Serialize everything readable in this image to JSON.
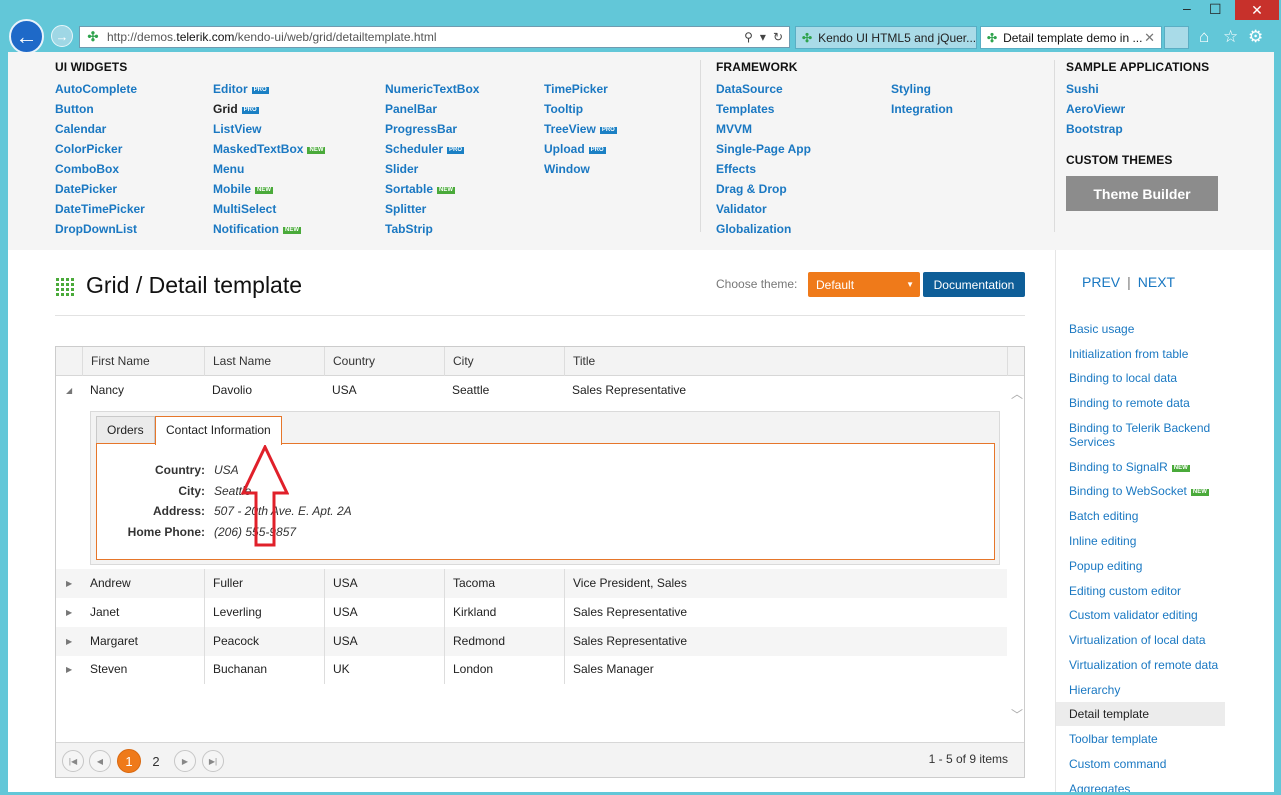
{
  "browser": {
    "url_host_prefix": "http://demos.",
    "url_host": "telerik.com",
    "url_path": "/kendo-ui/web/grid/detailtemplate.html",
    "tabs": [
      {
        "title": "Kendo UI HTML5 and jQuer..."
      },
      {
        "title": "Detail template demo in ..."
      }
    ]
  },
  "menu": {
    "ui_widgets_title": "UI WIDGETS",
    "col1": [
      "AutoComplete",
      "Button",
      "Calendar",
      "ColorPicker",
      "ComboBox",
      "DatePicker",
      "DateTimePicker",
      "DropDownList"
    ],
    "col2": [
      {
        "label": "Editor",
        "badge": "PRO"
      },
      {
        "label": "Grid",
        "badge": "PRO"
      },
      {
        "label": "ListView",
        "badge": ""
      },
      {
        "label": "MaskedTextBox",
        "badge": "NEW"
      },
      {
        "label": "Menu",
        "badge": ""
      },
      {
        "label": "Mobile",
        "badge": "NEW"
      },
      {
        "label": "MultiSelect",
        "badge": ""
      },
      {
        "label": "Notification",
        "badge": "NEW"
      }
    ],
    "col3": [
      {
        "label": "NumericTextBox",
        "badge": ""
      },
      {
        "label": "PanelBar",
        "badge": ""
      },
      {
        "label": "ProgressBar",
        "badge": ""
      },
      {
        "label": "Scheduler",
        "badge": "PRO"
      },
      {
        "label": "Slider",
        "badge": ""
      },
      {
        "label": "Sortable",
        "badge": "NEW"
      },
      {
        "label": "Splitter",
        "badge": ""
      },
      {
        "label": "TabStrip",
        "badge": ""
      }
    ],
    "col4": [
      {
        "label": "TimePicker",
        "badge": ""
      },
      {
        "label": "Tooltip",
        "badge": ""
      },
      {
        "label": "TreeView",
        "badge": "PRO"
      },
      {
        "label": "Upload",
        "badge": "PRO"
      },
      {
        "label": "Window",
        "badge": ""
      }
    ],
    "framework_title": "FRAMEWORK",
    "col5": [
      "DataSource",
      "Templates",
      "MVVM",
      "Single-Page App",
      "Effects",
      "Drag & Drop",
      "Validator",
      "Globalization"
    ],
    "col6": [
      "Styling",
      "Integration"
    ],
    "samples_title": "SAMPLE APPLICATIONS",
    "samples": [
      "Sushi",
      "AeroViewr",
      "Bootstrap"
    ],
    "themes_title": "CUSTOM THEMES",
    "theme_builder": "Theme Builder"
  },
  "header": {
    "title": "Grid / Detail template",
    "choose_theme_label": "Choose theme:",
    "theme_value": "Default",
    "documentation": "Documentation"
  },
  "nav": {
    "prev": "PREV",
    "sep": "|",
    "next": "NEXT",
    "links": [
      {
        "label": "Basic usage",
        "badge": ""
      },
      {
        "label": "Initialization from table",
        "badge": ""
      },
      {
        "label": "Binding to local data",
        "badge": ""
      },
      {
        "label": "Binding to remote data",
        "badge": ""
      },
      {
        "label": "Binding to Telerik Backend Services",
        "badge": ""
      },
      {
        "label": "Binding to SignalR",
        "badge": "NEW"
      },
      {
        "label": "Binding to WebSocket",
        "badge": "NEW"
      },
      {
        "label": "Batch editing",
        "badge": ""
      },
      {
        "label": "Inline editing",
        "badge": ""
      },
      {
        "label": "Popup editing",
        "badge": ""
      },
      {
        "label": "Editing custom editor",
        "badge": ""
      },
      {
        "label": "Custom validator editing",
        "badge": ""
      },
      {
        "label": "Virtualization of local data",
        "badge": ""
      },
      {
        "label": "Virtualization of remote data",
        "badge": ""
      },
      {
        "label": "Hierarchy",
        "badge": ""
      },
      {
        "label": "Detail template",
        "badge": "",
        "current": true
      },
      {
        "label": "Toolbar template",
        "badge": ""
      },
      {
        "label": "Custom command",
        "badge": ""
      },
      {
        "label": "Aggregates",
        "badge": ""
      }
    ]
  },
  "grid": {
    "columns": [
      "First Name",
      "Last Name",
      "Country",
      "City",
      "Title"
    ],
    "rows": [
      [
        "Nancy",
        "Davolio",
        "USA",
        "Seattle",
        "Sales Representative"
      ],
      [
        "Andrew",
        "Fuller",
        "USA",
        "Tacoma",
        "Vice President, Sales"
      ],
      [
        "Janet",
        "Leverling",
        "USA",
        "Kirkland",
        "Sales Representative"
      ],
      [
        "Margaret",
        "Peacock",
        "USA",
        "Redmond",
        "Sales Representative"
      ],
      [
        "Steven",
        "Buchanan",
        "UK",
        "London",
        "Sales Manager"
      ]
    ],
    "detail": {
      "tabs": [
        "Orders",
        "Contact Information"
      ],
      "fields": [
        {
          "label": "Country:",
          "value": "USA"
        },
        {
          "label": "City:",
          "value": "Seattle"
        },
        {
          "label": "Address:",
          "value": "507 - 20th Ave. E. Apt. 2A"
        },
        {
          "label": "Home Phone:",
          "value": "(206) 555-9857"
        }
      ]
    },
    "pager": {
      "pages": [
        "1",
        "2"
      ],
      "current": "1",
      "info": "1 - 5 of 9 items"
    }
  },
  "colors": {
    "accent": "#ef7a1a",
    "link": "#1a78c2",
    "doc_button": "#0e5e98",
    "arrow": "#e0202a"
  }
}
